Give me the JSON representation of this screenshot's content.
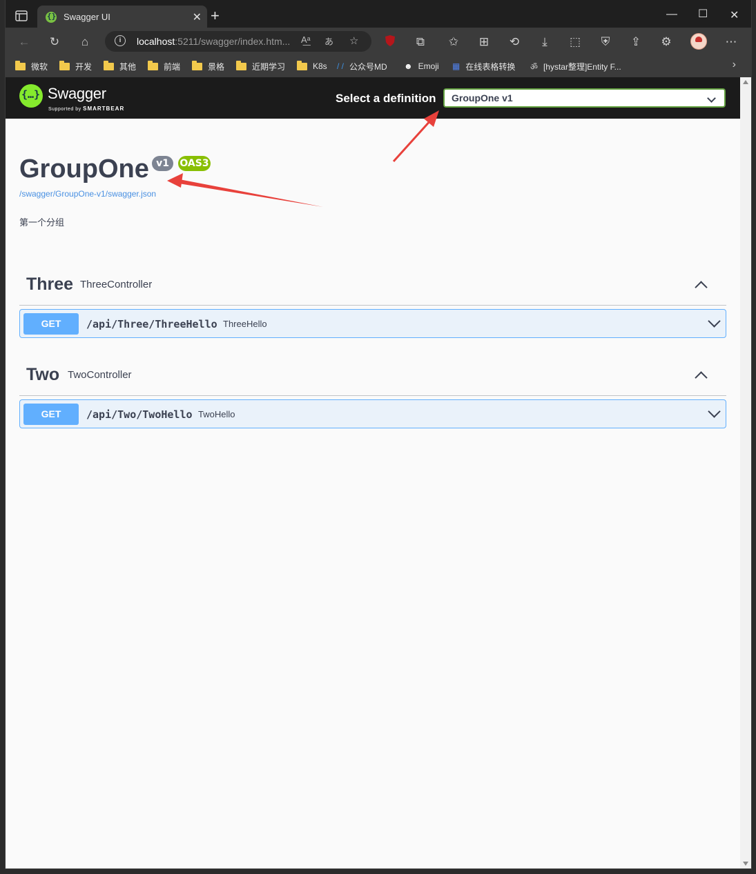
{
  "browser": {
    "tab_title": "Swagger UI",
    "tab_close": "✕",
    "new_tab": "+",
    "url_host": "localhost",
    "url_rest": ":5211/swagger/index.htm...",
    "bookmarks": [
      "微软",
      "开发",
      "其他",
      "前端",
      "景格",
      "近期学习",
      "K8s",
      "公众号MD",
      "Emoji",
      "在线表格转换",
      "[hystar整理]Entity F..."
    ]
  },
  "swagger": {
    "brand": "Swagger",
    "supported_by": "Supported by",
    "smartbear": "SMARTBEAR",
    "select_label": "Select a definition",
    "selected_definition": "GroupOne v1",
    "info": {
      "title": "GroupOne",
      "version": "v1",
      "oas": "OAS3",
      "json_link": "/swagger/GroupOne-v1/swagger.json",
      "description": "第一个分组"
    },
    "tags": [
      {
        "name": "Three",
        "description": "ThreeController",
        "operations": [
          {
            "method": "GET",
            "path": "/api/Three/ThreeHello",
            "summary": "ThreeHello"
          }
        ]
      },
      {
        "name": "Two",
        "description": "TwoController",
        "operations": [
          {
            "method": "GET",
            "path": "/api/Two/TwoHello",
            "summary": "TwoHello"
          }
        ]
      }
    ]
  },
  "colors": {
    "get_method": "#61affe",
    "swagger_green": "#85ea2d",
    "oas_badge": "#89bf04",
    "annotation_arrow": "#e8413b"
  }
}
